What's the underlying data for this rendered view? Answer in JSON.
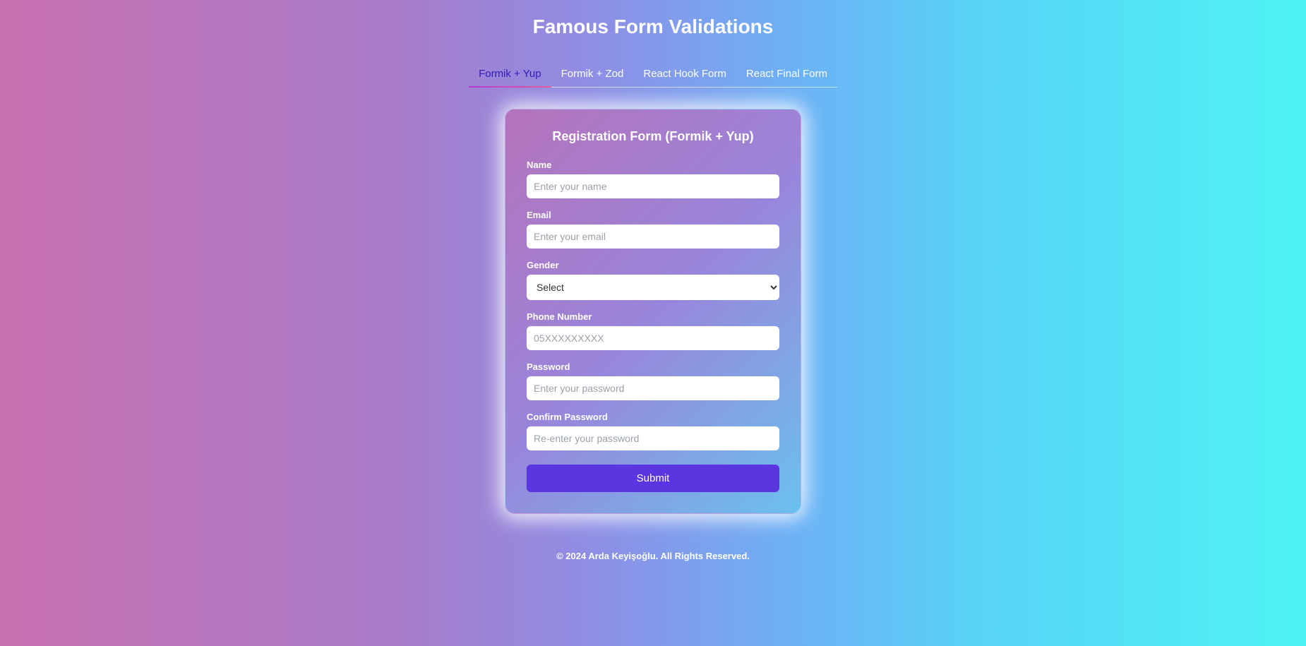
{
  "page_title": "Famous Form Validations",
  "tabs": [
    {
      "label": "Formik + Yup",
      "active": true
    },
    {
      "label": "Formik + Zod",
      "active": false
    },
    {
      "label": "React Hook Form",
      "active": false
    },
    {
      "label": "React Final Form",
      "active": false
    }
  ],
  "form": {
    "title": "Registration Form (Formik + Yup)",
    "name": {
      "label": "Name",
      "placeholder": "Enter your name"
    },
    "email": {
      "label": "Email",
      "placeholder": "Enter your email"
    },
    "gender": {
      "label": "Gender",
      "selected": "Select"
    },
    "phone": {
      "label": "Phone Number",
      "placeholder": "05XXXXXXXXX"
    },
    "password": {
      "label": "Password",
      "placeholder": "Enter your password"
    },
    "confirm": {
      "label": "Confirm Password",
      "placeholder": "Re-enter your password"
    },
    "submit_label": "Submit"
  },
  "footer": "© 2024 Arda Keyişoğlu. All Rights Reserved."
}
